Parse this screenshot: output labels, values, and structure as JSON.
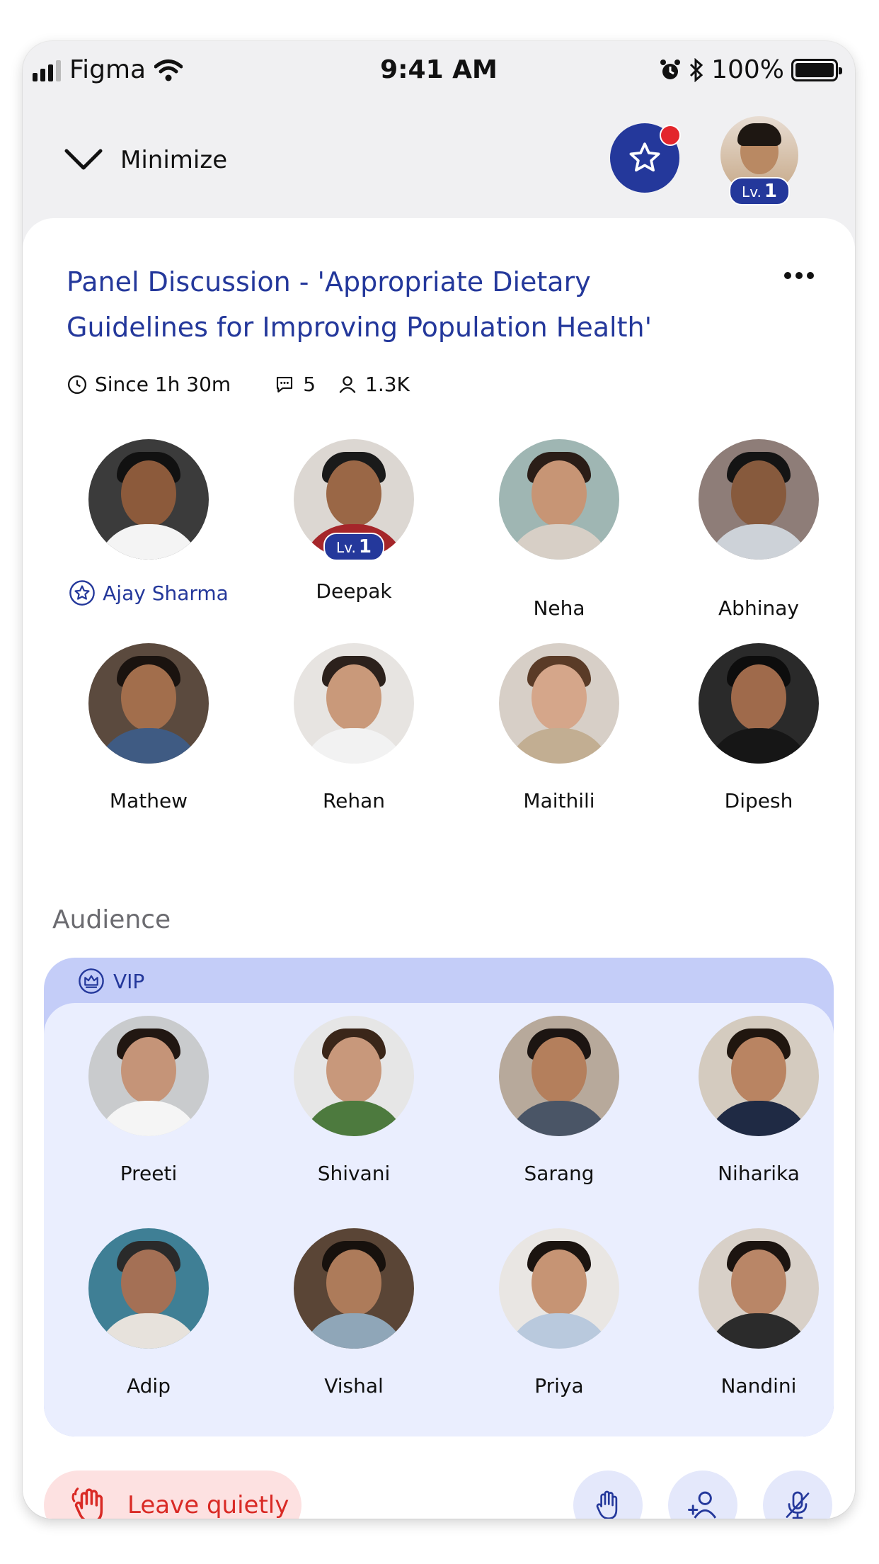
{
  "status_bar": {
    "carrier": "Figma",
    "time": "9:41 AM",
    "battery": "100%"
  },
  "header": {
    "minimize_label": "Minimize",
    "profile_level_prefix": "Lv.",
    "profile_level": "1"
  },
  "room": {
    "title_line1": "Panel Discussion - 'Appropriate Dietary",
    "title_line2": "Guidelines for Improving Population Health'",
    "since": "Since 1h 30m",
    "comments": "5",
    "listeners": "1.3K"
  },
  "speakers": [
    {
      "name": "Ajay Sharma",
      "host": true
    },
    {
      "name": "Deepak",
      "level_prefix": "Lv.",
      "level": "1"
    },
    {
      "name": "Neha"
    },
    {
      "name": "Abhinay"
    },
    {
      "name": "Mathew"
    },
    {
      "name": "Rehan"
    },
    {
      "name": "Maithili"
    },
    {
      "name": "Dipesh"
    }
  ],
  "audience": {
    "title": "Audience",
    "vip_label": "VIP",
    "members": [
      {
        "name": "Preeti"
      },
      {
        "name": "Shivani"
      },
      {
        "name": "Sarang"
      },
      {
        "name": "Niharika"
      },
      {
        "name": "Adip"
      },
      {
        "name": "Vishal"
      },
      {
        "name": "Priya"
      },
      {
        "name": "Nandini"
      }
    ]
  },
  "actions": {
    "leave_label": "Leave quietly"
  },
  "colors": {
    "brand": "#24389b",
    "danger": "#d92a25",
    "vip_band": "#c4cdf8",
    "vip_bg": "#eaeefe",
    "notification": "#e3262c"
  },
  "icons": [
    "signal-icon",
    "wifi-icon",
    "alarm-icon",
    "bluetooth-icon",
    "battery-icon",
    "chevron-down-icon",
    "star-icon",
    "more-icon",
    "clock-icon",
    "chat-icon",
    "user-icon",
    "crown-icon",
    "waving-hand-icon",
    "raise-hand-icon",
    "add-user-icon",
    "mic-off-icon"
  ]
}
